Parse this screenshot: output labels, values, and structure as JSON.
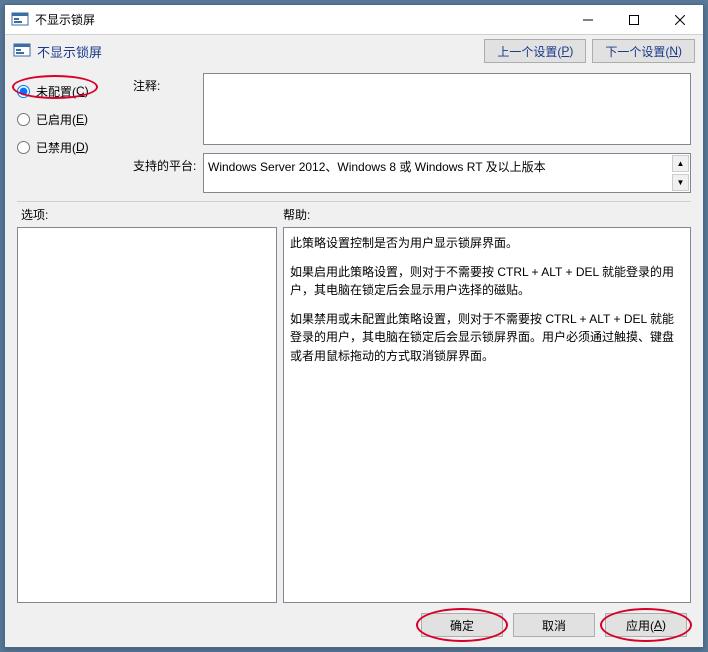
{
  "window": {
    "title": "不显示锁屏"
  },
  "toolbar": {
    "policy_name": "不显示锁屏",
    "prev_label": "上一个设置(",
    "prev_key": "P",
    "prev_suffix": ")",
    "next_label": "下一个设置(",
    "next_key": "N",
    "next_suffix": ")"
  },
  "radios": {
    "not_configured_label": "未配置(",
    "not_configured_key": "C",
    "enabled_label": "已启用(",
    "enabled_key": "E",
    "disabled_label": "已禁用(",
    "disabled_key": "D",
    "suffix": ")"
  },
  "form": {
    "comment_label": "注释:",
    "comment_value": "",
    "platform_label": "支持的平台:",
    "platform_value": "Windows Server 2012、Windows 8 或 Windows RT 及以上版本"
  },
  "sections": {
    "options_label": "选项:",
    "help_label": "帮助:"
  },
  "help": {
    "p1": "此策略设置控制是否为用户显示锁屏界面。",
    "p2": "如果启用此策略设置，则对于不需要按 CTRL + ALT + DEL  就能登录的用户，其电脑在锁定后会显示用户选择的磁贴。",
    "p3": "如果禁用或未配置此策略设置，则对于不需要按 CTRL + ALT + DEL 就能登录的用户，其电脑在锁定后会显示锁屏界面。用户必须通过触摸、键盘或者用鼠标拖动的方式取消锁屏界面。"
  },
  "footer": {
    "ok_label": "确定",
    "cancel_label": "取消",
    "apply_label": "应用(",
    "apply_key": "A",
    "apply_suffix": ")"
  }
}
